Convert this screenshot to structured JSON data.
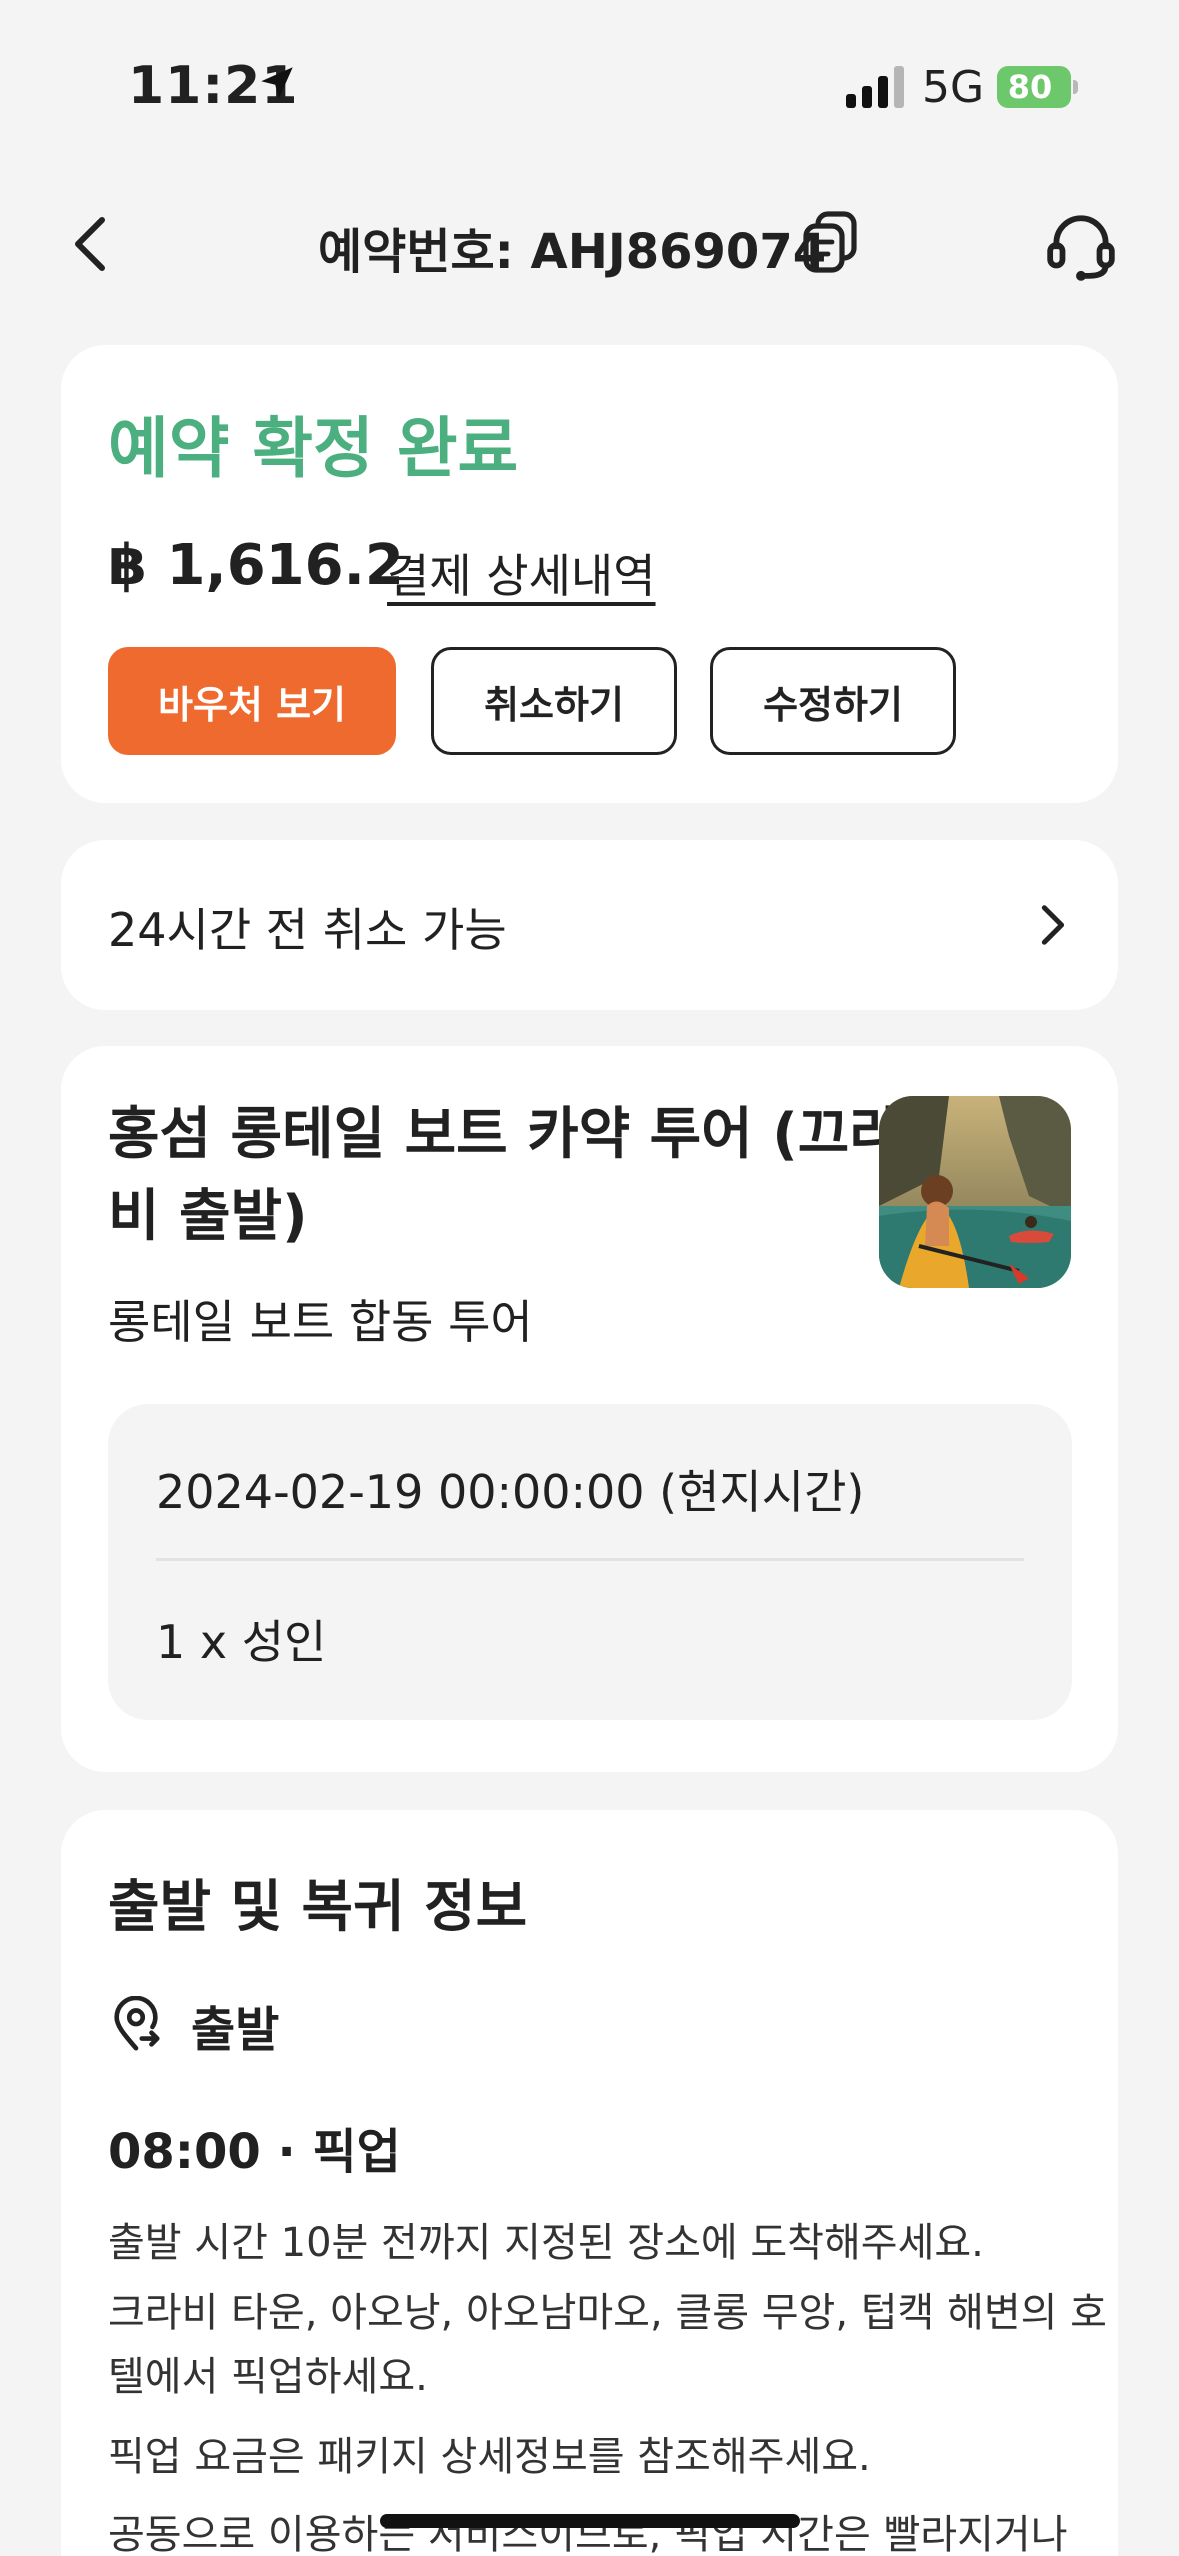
{
  "status_bar": {
    "time": "11:21",
    "network": "5G",
    "battery": "80"
  },
  "nav": {
    "title": "예약번호: AHJ869074"
  },
  "booking": {
    "status": "예약 확정 완료",
    "price": "฿ 1,616.2",
    "payment_details_link": "결제 상세내역",
    "buttons": {
      "voucher": "바우처 보기",
      "cancel": "취소하기",
      "modify": "수정하기"
    }
  },
  "policy": {
    "text": "24시간 전 취소 가능"
  },
  "product": {
    "title": "홍섬 롱테일 보트 카약 투어 (끄라비 출발)",
    "subtitle": "롱테일 보트 합동 투어",
    "date": "2024-02-19 00:00:00 (현지시간)",
    "quantity": "1 x 성인"
  },
  "departure_info": {
    "title": "출발 및 복귀 정보",
    "departure_label": "출발",
    "pickup_time": "08:00 · 픽업",
    "lines": [
      "출발 시간 10분 전까지 지정된 장소에 도착해주세요.",
      "크라비 타운, 아오낭, 아오남마오, 클롱 무앙, 텁캑 해변의 호",
      "텔에서 픽업하세요.",
      "픽업 요금은 패키지 상세정보를 참조해주세요.",
      "공동으로 이용하는 서비스이므로, 픽업 시간은 빨라지거나"
    ]
  },
  "colors": {
    "accent": "#ef6a2e",
    "success": "#4caf7f",
    "battery": "#6cc86a"
  },
  "icons": [
    "location-arrow-icon",
    "signal-icon",
    "battery-icon",
    "back-chevron-icon",
    "copy-icon",
    "headset-icon",
    "chevron-right-icon",
    "pin-icon"
  ]
}
